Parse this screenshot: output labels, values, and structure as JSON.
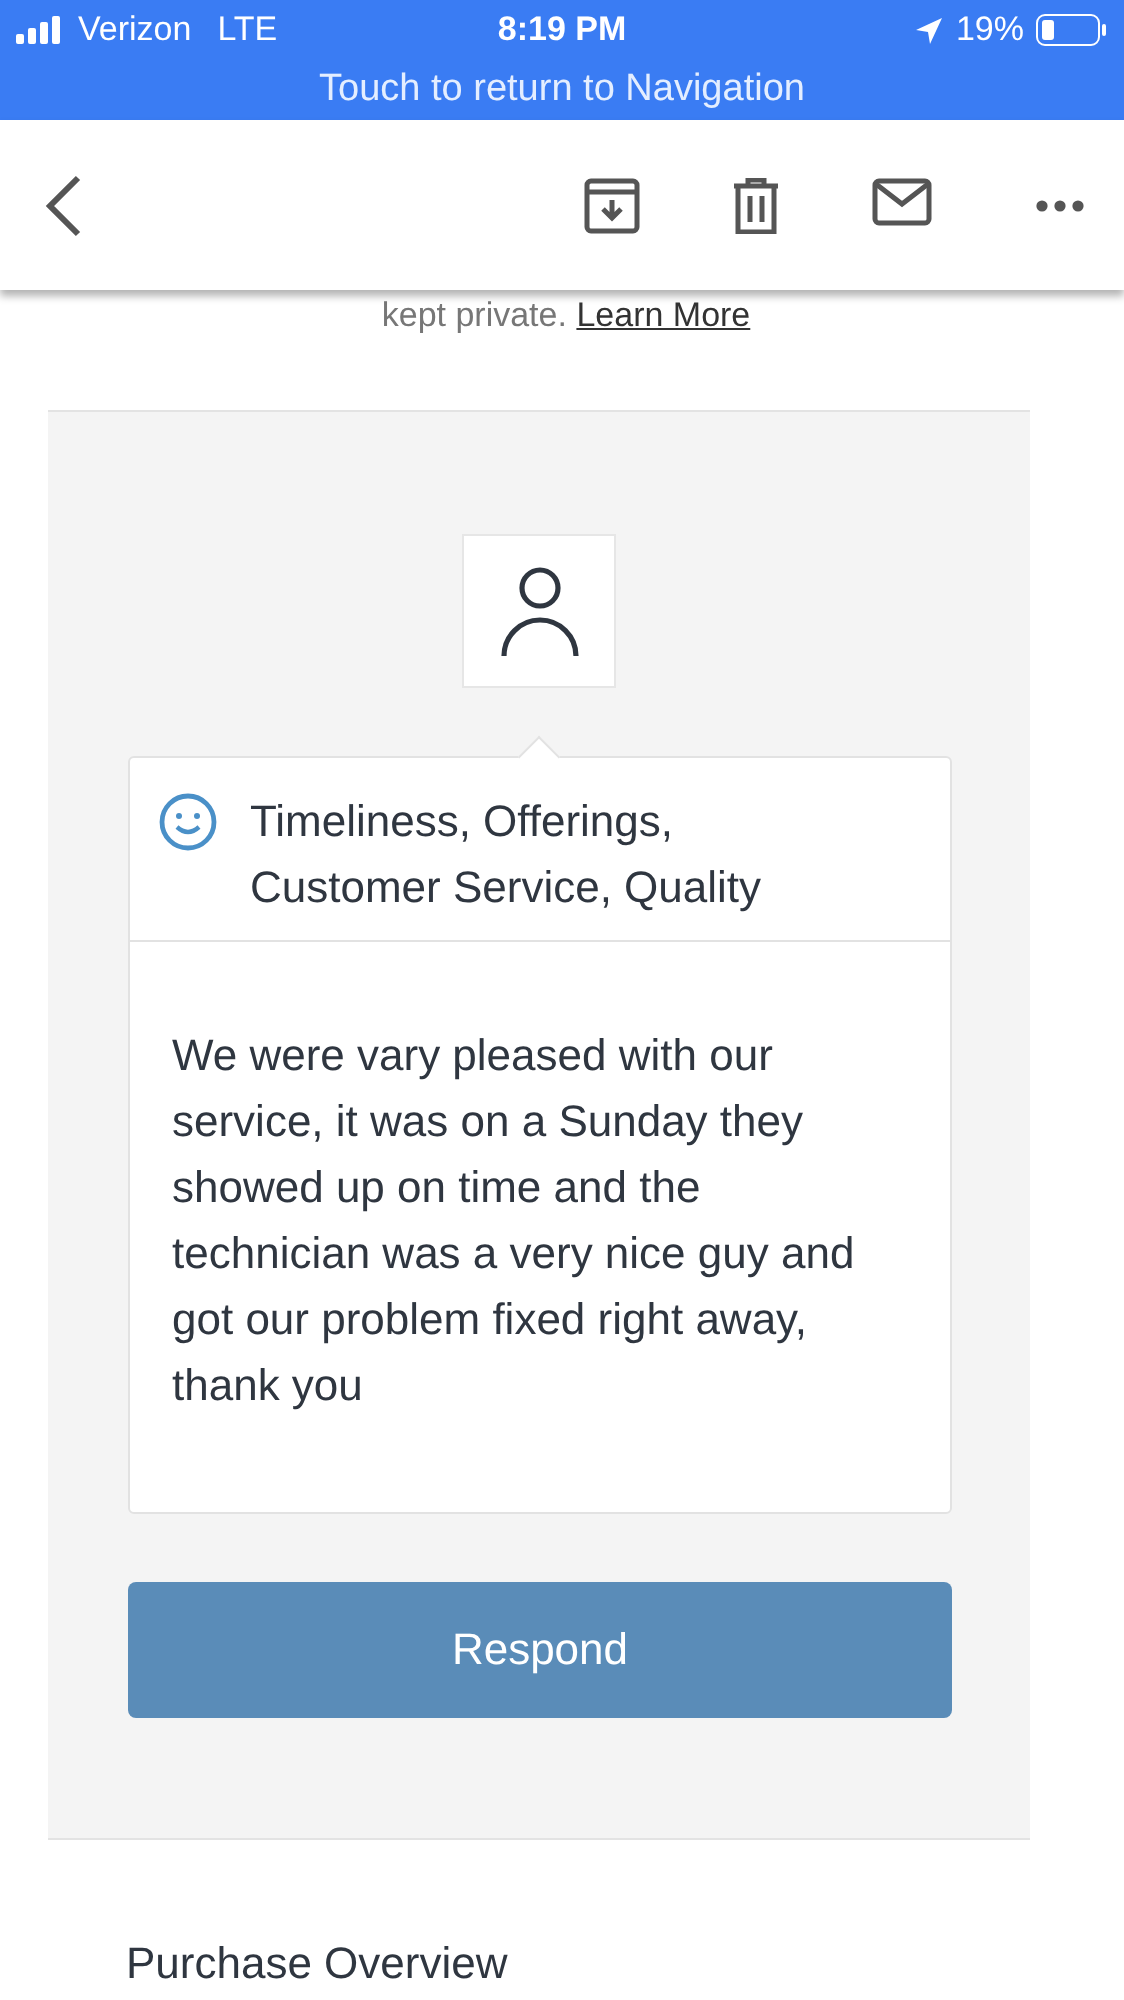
{
  "status_bar": {
    "carrier": "Verizon",
    "network": "LTE",
    "time": "8:19 PM",
    "battery": "19%"
  },
  "navigation_banner": "Touch to return to Navigation",
  "notice": {
    "text": "kept private.",
    "link": "Learn More"
  },
  "review": {
    "topics": "Timeliness, Offerings, Customer Service, Quality",
    "comment": "We were vary pleased with our service, it was on a Sunday they showed up on time and the technician was a very nice guy and got our problem fixed right away, thank you",
    "button": "Respond"
  },
  "section_title": "Purchase Overview"
}
